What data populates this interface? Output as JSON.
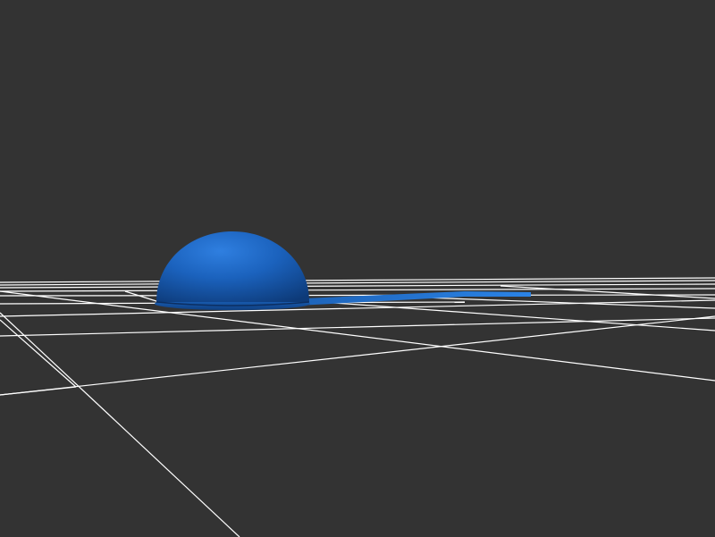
{
  "scene": {
    "background_color": "#333333",
    "grid_color": "#ffffff",
    "object_color": "#1a5fb4",
    "objects": [
      {
        "name": "blue-hemisphere",
        "shape": "hemisphere"
      },
      {
        "name": "blue-base-disc",
        "shape": "disc"
      },
      {
        "name": "blue-flat-arm",
        "shape": "thin-plate"
      }
    ]
  }
}
